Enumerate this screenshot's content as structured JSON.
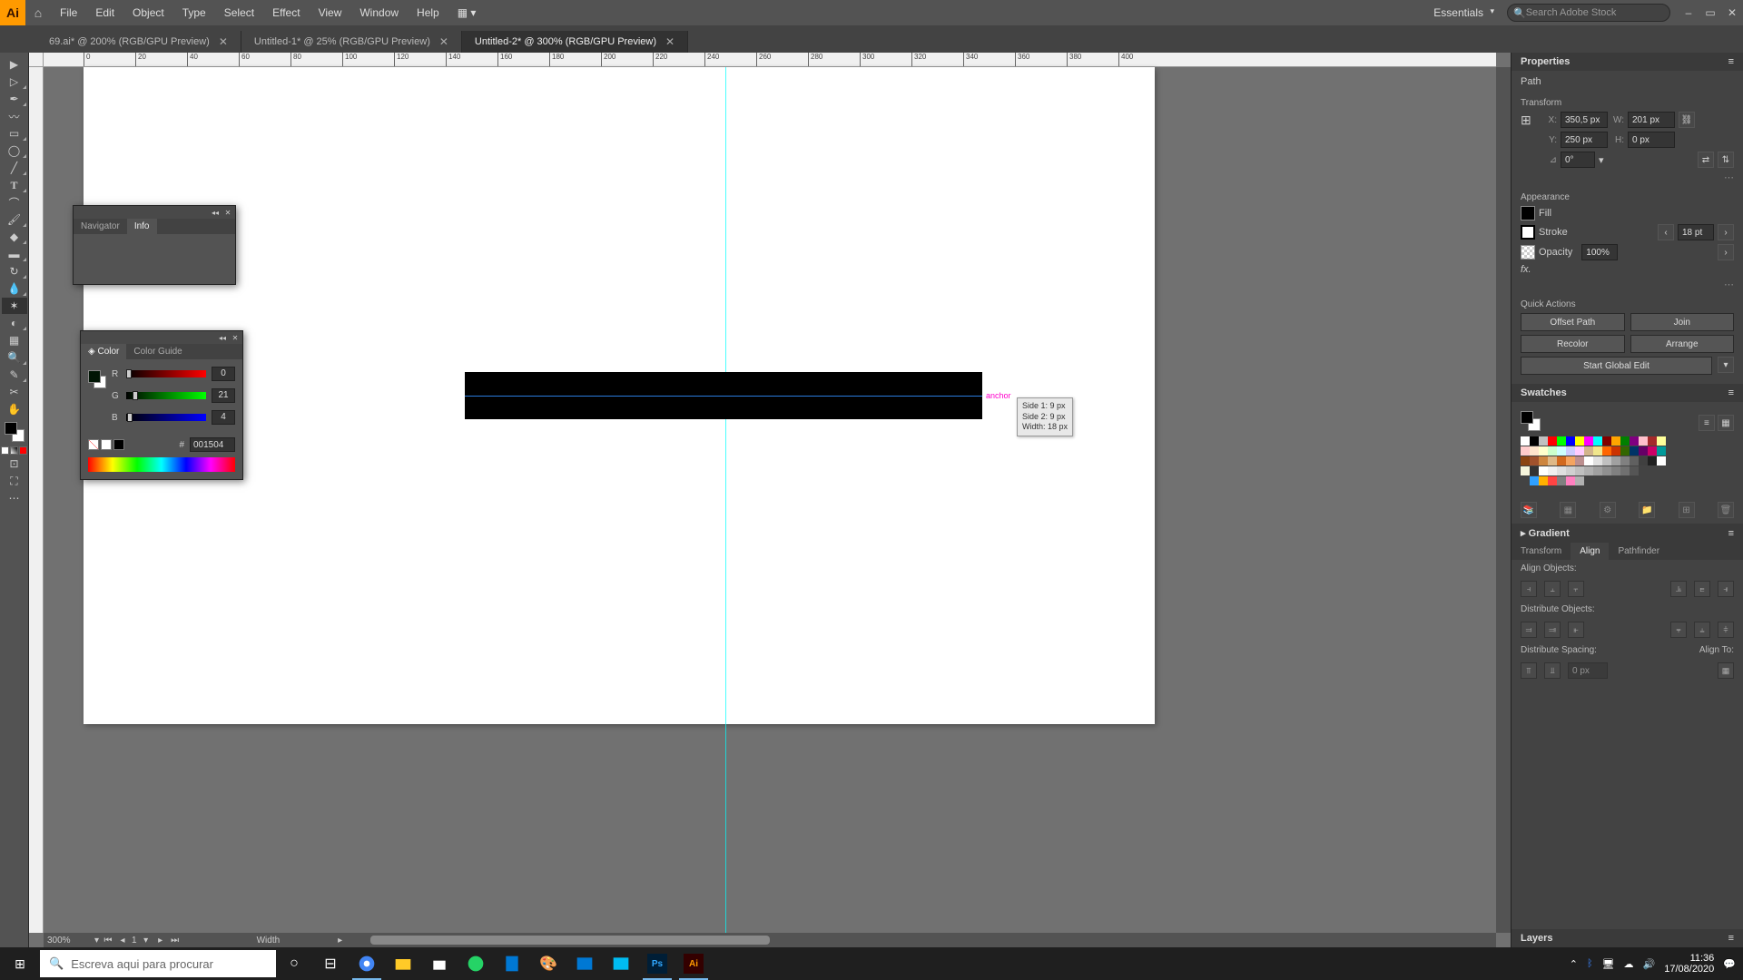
{
  "menubar": {
    "items": [
      "File",
      "Edit",
      "Object",
      "Type",
      "Select",
      "Effect",
      "View",
      "Window",
      "Help"
    ],
    "workspace": "Essentials",
    "search_placeholder": "Search Adobe Stock"
  },
  "tabs": [
    {
      "title": "69.ai* @ 200% (RGB/GPU Preview)",
      "active": false
    },
    {
      "title": "Untitled-1* @ 25% (RGB/GPU Preview)",
      "active": false
    },
    {
      "title": "Untitled-2* @ 300% (RGB/GPU Preview)",
      "active": true
    }
  ],
  "ruler_ticks": [
    "0",
    "20",
    "40",
    "60",
    "80",
    "100",
    "120",
    "140",
    "160",
    "180",
    "200",
    "220",
    "240",
    "260",
    "280",
    "300",
    "320",
    "340",
    "360",
    "380",
    "400"
  ],
  "tooltip": {
    "l1": "Side 1: 9 px",
    "l2": "Side 2: 9 px",
    "l3": "Width:  18 px"
  },
  "anchor_label": "anchor",
  "zoom": {
    "value": "300%",
    "page": "1",
    "tool": "Width"
  },
  "properties": {
    "title": "Properties",
    "sel_type": "Path",
    "transform": "Transform",
    "x": "350,5 px",
    "y": "250 px",
    "w": "201 px",
    "h": "0 px",
    "angle": "0°",
    "appearance": "Appearance",
    "fill": "Fill",
    "stroke": "Stroke",
    "stroke_w": "18 pt",
    "opacity": "Opacity",
    "opac_v": "100%",
    "quick": "Quick Actions",
    "btn_offset": "Offset Path",
    "btn_join": "Join",
    "btn_recolor": "Recolor",
    "btn_arrange": "Arrange",
    "btn_global": "Start Global Edit"
  },
  "swatches_title": "Swatches",
  "gradient_title": "Gradient",
  "align": {
    "tabs": [
      "Transform",
      "Align",
      "Pathfinder"
    ],
    "h1": "Align Objects:",
    "h2": "Distribute Objects:",
    "h3": "Distribute Spacing:",
    "h4": "Align To:"
  },
  "layers_title": "Layers",
  "float_info": {
    "tabs": [
      "Navigator",
      "Info"
    ]
  },
  "float_color": {
    "tabs": [
      "Color",
      "Color Guide"
    ],
    "r": "0",
    "g": "21",
    "b": "4",
    "hex": "001504"
  },
  "taskbar": {
    "search": "Escreva aqui para procurar",
    "time": "11:36",
    "date": "17/08/2020"
  },
  "swatch_rows": [
    [
      "#fff",
      "#000",
      "#c0c0c0",
      "#ff0000",
      "#00ff00",
      "#0000ff",
      "#ffff00",
      "#ff00ff",
      "#00ffff",
      "#800000",
      "#ffa500",
      "#008000",
      "#800080",
      "#ffc0cb",
      "#a52a2a",
      "#ffff99"
    ],
    [
      "#ffcccc",
      "#ffe5cc",
      "#ffffcc",
      "#ccffcc",
      "#ccffff",
      "#ccccff",
      "#ffccff",
      "#d2b48c",
      "#f0e68c",
      "#ff6600",
      "#cc3300",
      "#336600",
      "#003366",
      "#660066",
      "#cc0066",
      "#009999"
    ],
    [
      "#8b4513",
      "#a0522d",
      "#cd853f",
      "#deb887",
      "#d2691e",
      "#f4a460",
      "#bc8f8f",
      "#ffffff",
      "#e0e0e0",
      "#c0c0c0",
      "#a0a0a0",
      "#808080",
      "#606060",
      "#404040",
      "#202020",
      "#ffffff"
    ],
    [
      "#f5f5dc",
      "#333333",
      "#ffffff",
      "#f0f0f0",
      "#e0e0e0",
      "#d0d0d0",
      "#c0c0c0",
      "#b0b0b0",
      "#a0a0a0",
      "#909090",
      "#808080",
      "#707070",
      "#555555"
    ],
    [
      "",
      "#30a0ff",
      "#ffb000",
      "#ff4444",
      "#808080",
      "#ff80c0",
      "#b0b0b0"
    ]
  ]
}
